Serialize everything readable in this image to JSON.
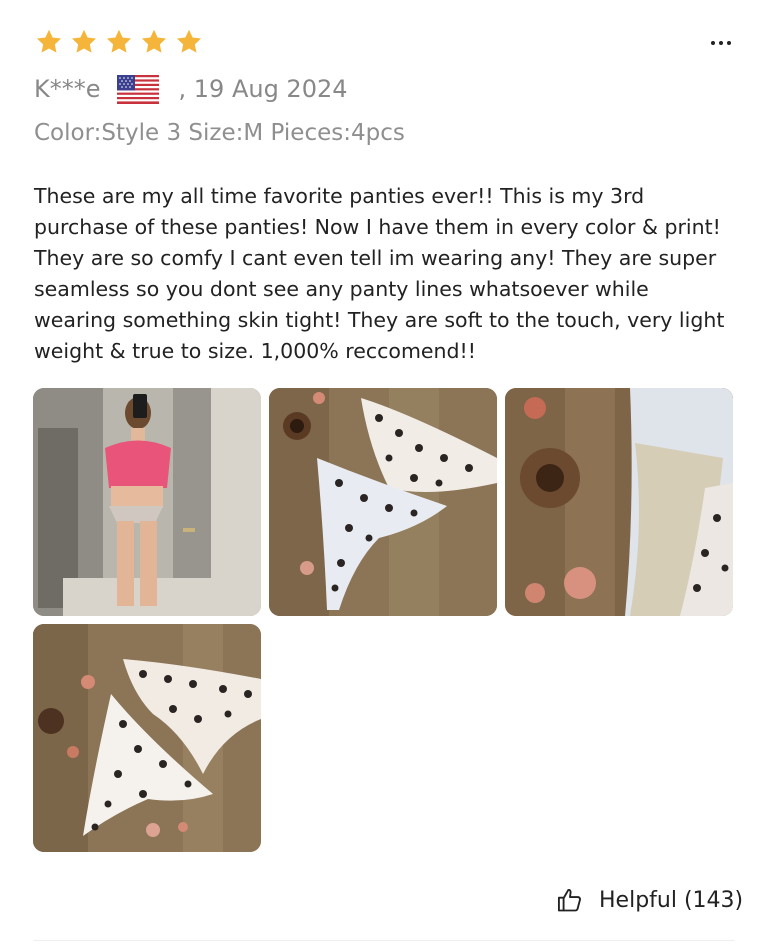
{
  "review": {
    "rating": 5,
    "max_rating": 5,
    "star_color": "#F5B53A",
    "reviewer": "K***e",
    "country_flag": "us-flag-icon",
    "date": ", 19 Aug 2024",
    "variant": "Color:Style 3 Size:M Pieces:4pcs",
    "text": "These are my all time favorite panties ever!! This is my 3rd purchase of these panties! Now I have them in every color & print! They are so comfy I cant even tell im wearing any! They are super seamless so you dont see any panty lines whatsoever while wearing something skin tight! They are soft to the touch, very light weight & true to size. 1,000% reccomend!!",
    "photos": [
      {
        "alt": "mirror selfie"
      },
      {
        "alt": "leopard print panties on wood"
      },
      {
        "alt": "panty lining close-up"
      },
      {
        "alt": "two leopard print panties"
      }
    ]
  },
  "actions": {
    "more_icon": "more-options-icon",
    "helpful_icon": "thumbs-up-icon",
    "helpful_label": "Helpful (143)"
  }
}
